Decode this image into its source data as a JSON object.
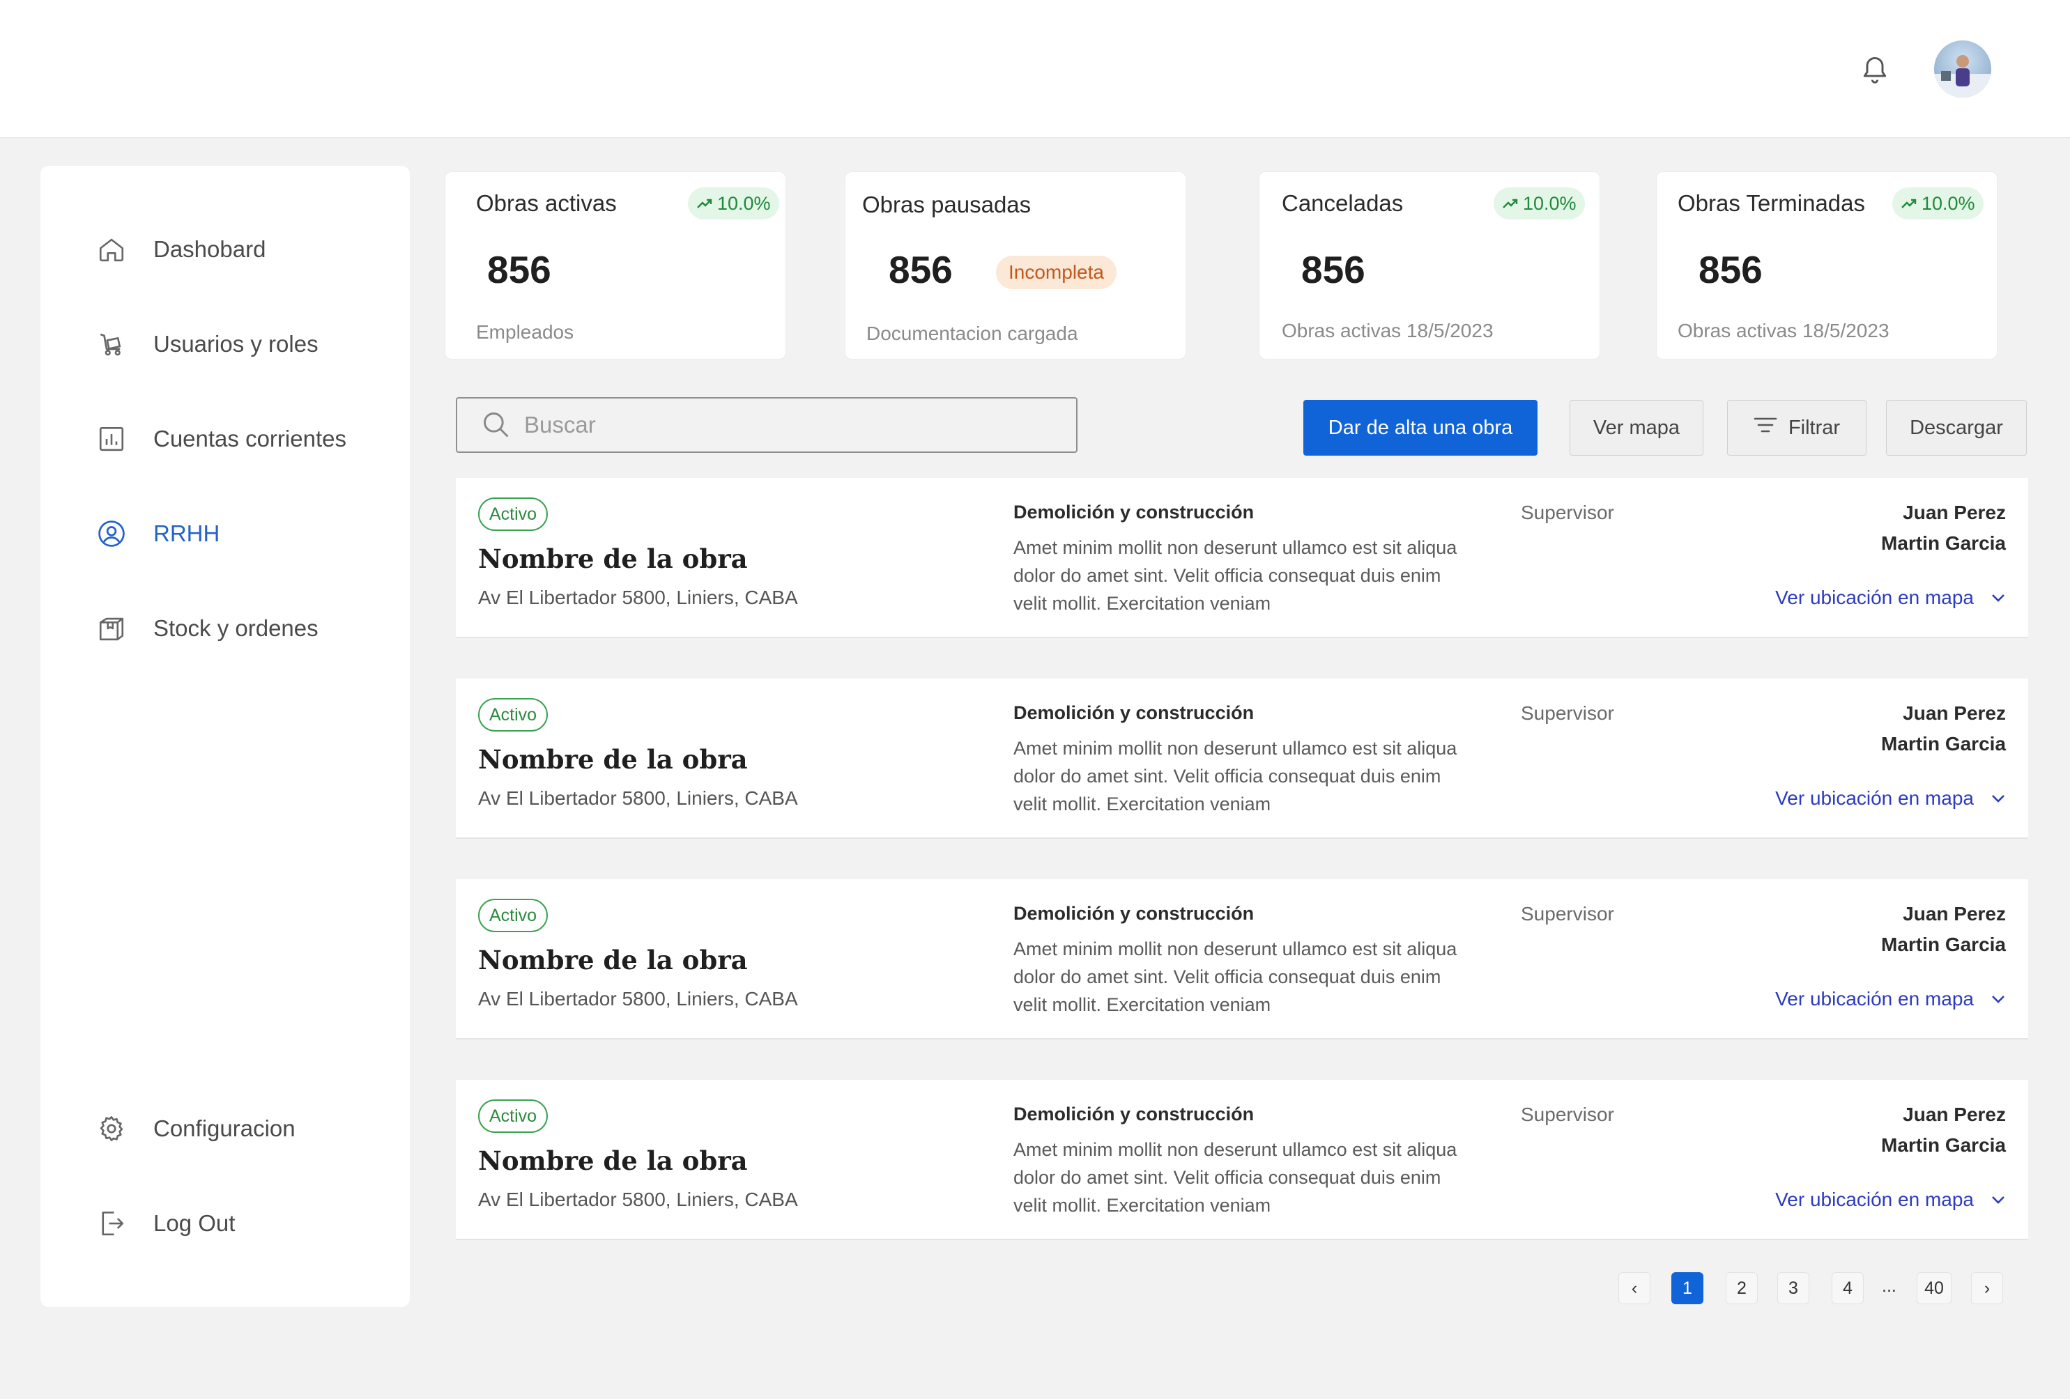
{
  "sidebar": {
    "items": [
      {
        "label": "Dashobard",
        "icon": "home-icon"
      },
      {
        "label": "Usuarios y roles",
        "icon": "users-icon"
      },
      {
        "label": "Cuentas corrientes",
        "icon": "chart-icon"
      },
      {
        "label": "RRHH",
        "icon": "user-circle-icon",
        "active": true
      },
      {
        "label": "Stock y ordenes",
        "icon": "box-icon"
      }
    ],
    "bottom": [
      {
        "label": "Configuracion",
        "icon": "gear-icon"
      },
      {
        "label": "Log Out",
        "icon": "logout-icon"
      }
    ]
  },
  "stats": [
    {
      "title": "Obras activas",
      "value": "856",
      "sub": "Empleados",
      "trend": "10.0%"
    },
    {
      "title": "Obras pausadas",
      "value": "856",
      "sub": "Documentacion cargada",
      "badge": "Incompleta"
    },
    {
      "title": "Canceladas",
      "value": "856",
      "sub": "Obras activas 18/5/2023",
      "trend": "10.0%"
    },
    {
      "title": "Obras Terminadas",
      "value": "856",
      "sub": "Obras activas 18/5/2023",
      "trend": "10.0%"
    }
  ],
  "toolbar": {
    "search_placeholder": "Buscar",
    "add_label": "Dar de alta una obra",
    "map_label": "Ver mapa",
    "filter_label": "Filtrar",
    "download_label": "Descargar"
  },
  "rows": [
    {
      "status": "Activo",
      "name": "Nombre de la obra",
      "address": "Av El Libertador 5800, Liniers, CABA",
      "category": "Demolición y construcción",
      "description": "Amet minim mollit non deserunt ullamco est sit aliqua dolor do amet sint. Velit officia consequat duis enim velit mollit. Exercitation veniam",
      "role": "Supervisor",
      "person1": "Juan Perez",
      "person2": "Martin Garcia",
      "map_link": "Ver ubicación en mapa"
    },
    {
      "status": "Activo",
      "name": "Nombre de la obra",
      "address": "Av El Libertador 5800, Liniers, CABA",
      "category": "Demolición y construcción",
      "description": "Amet minim mollit non deserunt ullamco est sit aliqua dolor do amet sint. Velit officia consequat duis enim velit mollit. Exercitation veniam",
      "role": "Supervisor",
      "person1": "Juan Perez",
      "person2": "Martin Garcia",
      "map_link": "Ver ubicación en mapa"
    },
    {
      "status": "Activo",
      "name": "Nombre de la obra",
      "address": "Av El Libertador 5800, Liniers, CABA",
      "category": "Demolición y construcción",
      "description": "Amet minim mollit non deserunt ullamco est sit aliqua dolor do amet sint. Velit officia consequat duis enim velit mollit. Exercitation veniam",
      "role": "Supervisor",
      "person1": "Juan Perez",
      "person2": "Martin Garcia",
      "map_link": "Ver ubicación en mapa"
    },
    {
      "status": "Activo",
      "name": "Nombre de la obra",
      "address": "Av El Libertador 5800, Liniers, CABA",
      "category": "Demolición y construcción",
      "description": "Amet minim mollit non deserunt ullamco est sit aliqua dolor do amet sint. Velit officia consequat duis enim velit mollit. Exercitation veniam",
      "role": "Supervisor",
      "person1": "Juan Perez",
      "person2": "Martin Garcia",
      "map_link": "Ver ubicación en mapa"
    }
  ],
  "pagination": {
    "prev": "‹",
    "pages": [
      "1",
      "2",
      "3",
      "4"
    ],
    "dots": "...",
    "last": "40",
    "next": "›",
    "current": "1"
  },
  "colors": {
    "accent": "#1163d8",
    "active_nav": "#2563c9",
    "status_green": "#2b8a3d",
    "link": "#2c3bbf",
    "warning_bg": "#fbe8d7"
  }
}
